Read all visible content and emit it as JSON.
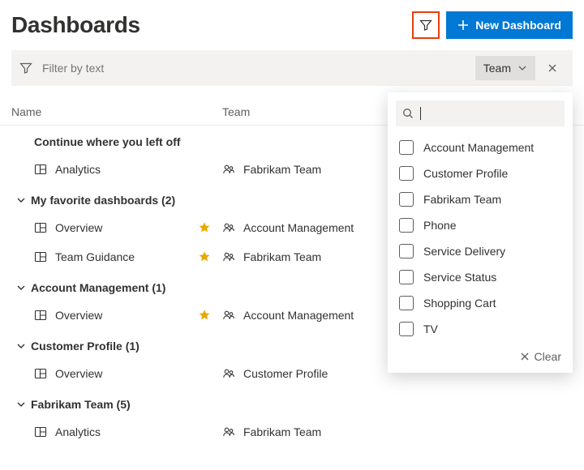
{
  "header": {
    "title": "Dashboards",
    "new_dashboard_label": "New Dashboard"
  },
  "filter_bar": {
    "placeholder": "Filter by text",
    "team_dropdown_label": "Team"
  },
  "columns": {
    "name": "Name",
    "team": "Team"
  },
  "groups": [
    {
      "label": "Continue where you left off",
      "show_chevron": false,
      "rows": [
        {
          "name": "Analytics",
          "team": "Fabrikam Team",
          "starred": false
        }
      ]
    },
    {
      "label": "My favorite dashboards (2)",
      "show_chevron": true,
      "rows": [
        {
          "name": "Overview",
          "team": "Account Management",
          "starred": true
        },
        {
          "name": "Team Guidance",
          "team": "Fabrikam Team",
          "starred": true
        }
      ]
    },
    {
      "label": "Account Management (1)",
      "show_chevron": true,
      "rows": [
        {
          "name": "Overview",
          "team": "Account Management",
          "starred": true
        }
      ]
    },
    {
      "label": "Customer Profile (1)",
      "show_chevron": true,
      "rows": [
        {
          "name": "Overview",
          "team": "Customer Profile",
          "starred": false
        }
      ]
    },
    {
      "label": "Fabrikam Team (5)",
      "show_chevron": true,
      "rows": [
        {
          "name": "Analytics",
          "team": "Fabrikam Team",
          "starred": false
        }
      ]
    }
  ],
  "team_dropdown": {
    "options": [
      "Account Management",
      "Customer Profile",
      "Fabrikam Team",
      "Phone",
      "Service Delivery",
      "Service Status",
      "Shopping Cart",
      "TV"
    ],
    "clear_label": "Clear"
  }
}
